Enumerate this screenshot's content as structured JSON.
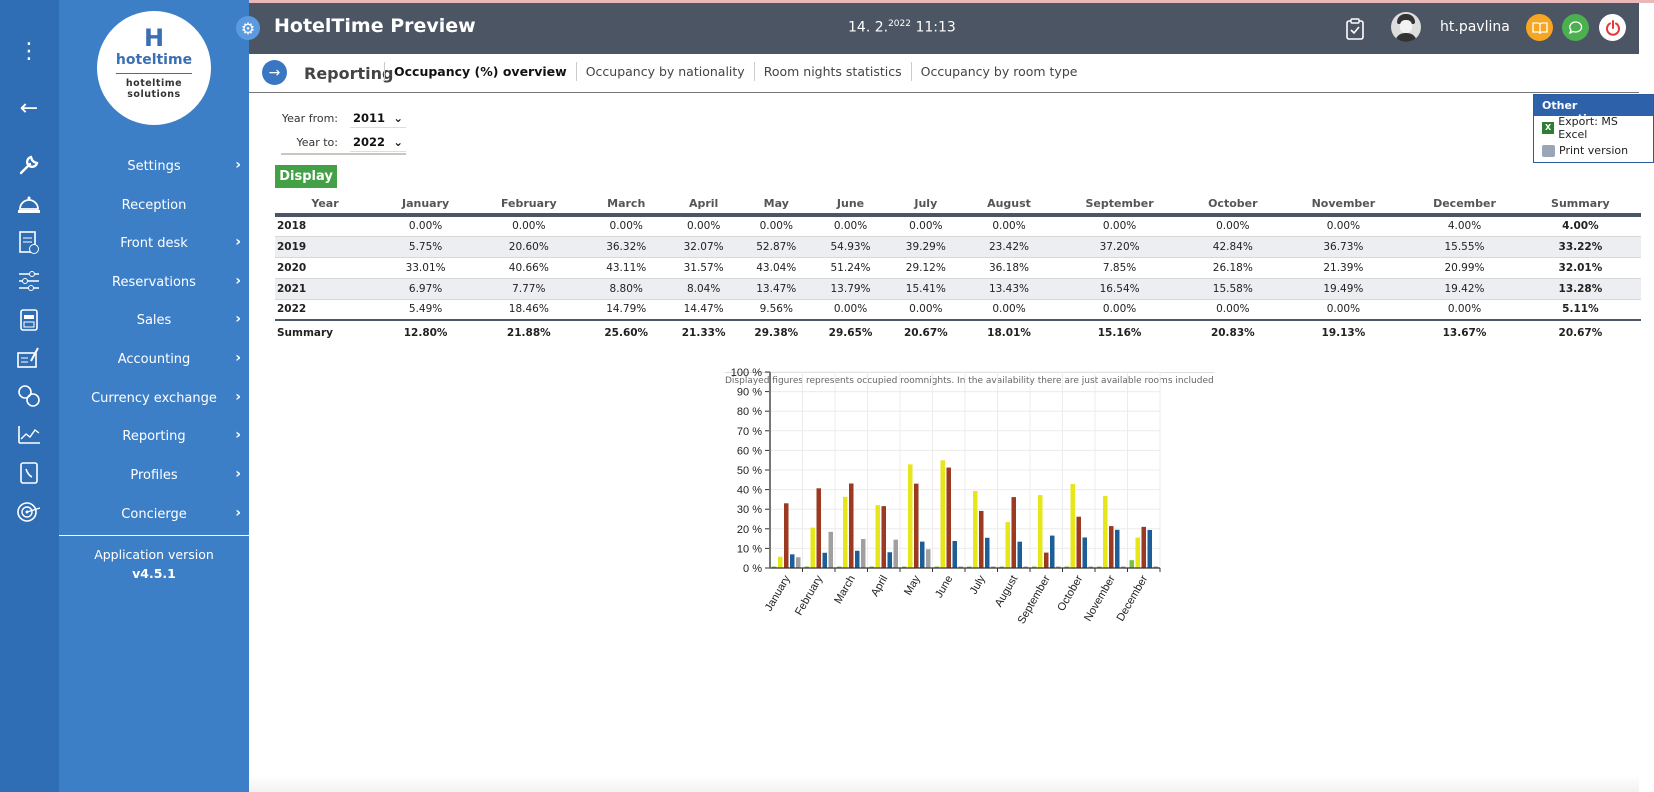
{
  "app": {
    "title": "HotelTime Preview",
    "date_main": "14. 2.",
    "date_year": "2022",
    "time": "11:13",
    "username": "ht.pavlina"
  },
  "logo": {
    "brand": "hoteltime",
    "sub_line1": "hoteltime",
    "sub_line2": "solutions"
  },
  "sidebar": {
    "items": [
      {
        "label": "Settings",
        "has_submenu": true,
        "icon": "wrench-icon"
      },
      {
        "label": "Reception",
        "has_submenu": false,
        "icon": "bell-icon"
      },
      {
        "label": "Front desk",
        "has_submenu": true,
        "icon": "clipboard-icon"
      },
      {
        "label": "Reservations",
        "has_submenu": true,
        "icon": "sliders-icon"
      },
      {
        "label": "Sales",
        "has_submenu": true,
        "icon": "calculator-icon"
      },
      {
        "label": "Accounting",
        "has_submenu": true,
        "icon": "invoice-pen-icon"
      },
      {
        "label": "Currency exchange",
        "has_submenu": true,
        "icon": "currency-icon"
      },
      {
        "label": "Reporting",
        "has_submenu": true,
        "icon": "chart-icon"
      },
      {
        "label": "Profiles",
        "has_submenu": true,
        "icon": "contacts-book-icon"
      },
      {
        "label": "Concierge",
        "has_submenu": true,
        "icon": "target-icon"
      }
    ],
    "app_version_label": "Application version",
    "app_version": "v4.5.1"
  },
  "subnav": {
    "section": "Reporting",
    "tabs": [
      {
        "label": "Occupancy (%) overview",
        "active": true
      },
      {
        "label": "Occupancy by nationality",
        "active": false
      },
      {
        "label": "Room nights statistics",
        "active": false
      },
      {
        "label": "Occupancy by room type",
        "active": false
      }
    ]
  },
  "filters": {
    "year_from_label": "Year from:",
    "year_from": "2011",
    "year_to_label": "Year to:",
    "year_to": "2022",
    "display_button": "Display"
  },
  "other_operations": {
    "title": "Other operations",
    "export_label": "Export: MS Excel",
    "print_label": "Print version"
  },
  "table": {
    "headers": [
      "Year",
      "January",
      "February",
      "March",
      "April",
      "May",
      "June",
      "July",
      "August",
      "September",
      "October",
      "November",
      "December",
      "Summary"
    ],
    "rows": [
      [
        "2018",
        "0.00%",
        "0.00%",
        "0.00%",
        "0.00%",
        "0.00%",
        "0.00%",
        "0.00%",
        "0.00%",
        "0.00%",
        "0.00%",
        "0.00%",
        "4.00%",
        "4.00%"
      ],
      [
        "2019",
        "5.75%",
        "20.60%",
        "36.32%",
        "32.07%",
        "52.87%",
        "54.93%",
        "39.29%",
        "23.42%",
        "37.20%",
        "42.84%",
        "36.73%",
        "15.55%",
        "33.22%"
      ],
      [
        "2020",
        "33.01%",
        "40.66%",
        "43.11%",
        "31.57%",
        "43.04%",
        "51.24%",
        "29.12%",
        "36.18%",
        "7.85%",
        "26.18%",
        "21.39%",
        "20.99%",
        "32.01%"
      ],
      [
        "2021",
        "6.97%",
        "7.77%",
        "8.80%",
        "8.04%",
        "13.47%",
        "13.79%",
        "15.41%",
        "13.43%",
        "16.54%",
        "15.58%",
        "19.49%",
        "19.42%",
        "13.28%"
      ],
      [
        "2022",
        "5.49%",
        "18.46%",
        "14.79%",
        "14.47%",
        "9.56%",
        "0.00%",
        "0.00%",
        "0.00%",
        "0.00%",
        "0.00%",
        "0.00%",
        "0.00%",
        "5.11%"
      ]
    ],
    "summary": [
      "Summary",
      "12.80%",
      "21.88%",
      "25.60%",
      "21.33%",
      "29.38%",
      "29.65%",
      "20.67%",
      "18.01%",
      "15.16%",
      "20.83%",
      "19.13%",
      "13.67%",
      "20.67%"
    ]
  },
  "chart_note": "Displayed figures represents occupied roomnights. In the availability there are just available rooms included",
  "chart_data": {
    "type": "bar",
    "title": "",
    "xlabel": "",
    "ylabel": "",
    "ylim": [
      0,
      100
    ],
    "yticks": [
      "0 %",
      "10 %",
      "20 %",
      "30 %",
      "40 %",
      "50 %",
      "60 %",
      "70 %",
      "80 %",
      "90 %",
      "100 %"
    ],
    "grid": true,
    "legend": "none",
    "categories": [
      "January",
      "February",
      "March",
      "April",
      "May",
      "June",
      "July",
      "August",
      "September",
      "October",
      "November",
      "December"
    ],
    "series": [
      {
        "name": "2018",
        "color": "#7cc242",
        "values": [
          0,
          0,
          0,
          0,
          0,
          0,
          0,
          0,
          0,
          0,
          0,
          4.0
        ]
      },
      {
        "name": "2019",
        "color": "#e6e619",
        "values": [
          5.75,
          20.6,
          36.32,
          32.07,
          52.87,
          54.93,
          39.29,
          23.42,
          37.2,
          42.84,
          36.73,
          15.55
        ]
      },
      {
        "name": "2020",
        "color": "#9b3a20",
        "values": [
          33.01,
          40.66,
          43.11,
          31.57,
          43.04,
          51.24,
          29.12,
          36.18,
          7.85,
          26.18,
          21.39,
          20.99
        ]
      },
      {
        "name": "2021",
        "color": "#1d5e99",
        "values": [
          6.97,
          7.77,
          8.8,
          8.04,
          13.47,
          13.79,
          15.41,
          13.43,
          16.54,
          15.58,
          19.49,
          19.42
        ]
      },
      {
        "name": "2022",
        "color": "#a0a0a0",
        "values": [
          5.49,
          18.46,
          14.79,
          14.47,
          9.56,
          0,
          0,
          0,
          0,
          0,
          0,
          0
        ]
      }
    ]
  }
}
